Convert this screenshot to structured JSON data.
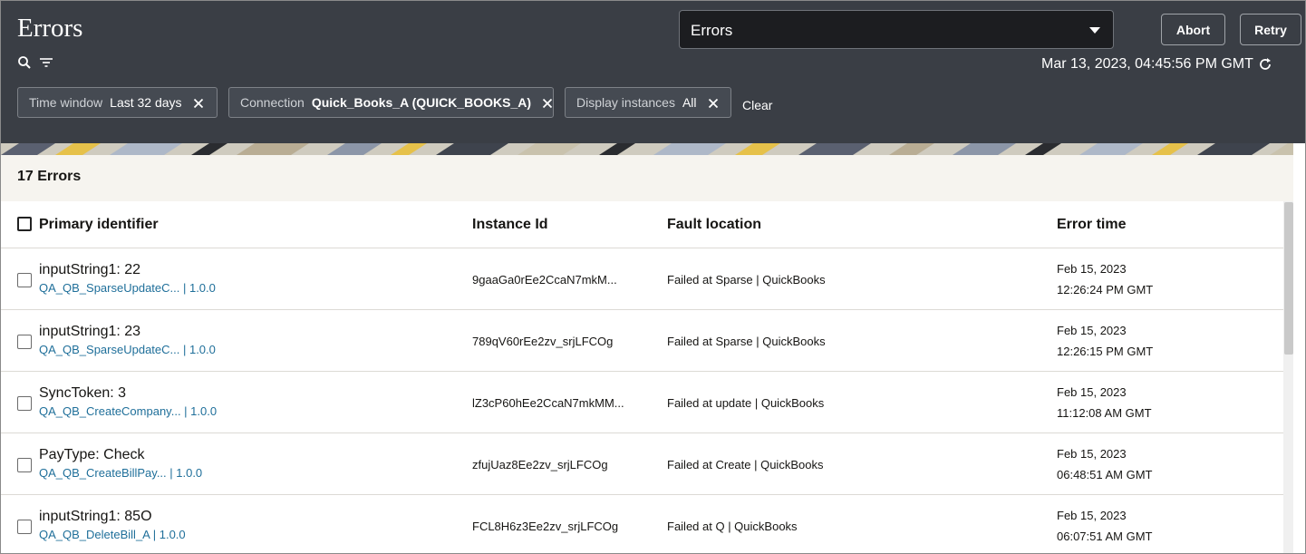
{
  "header": {
    "title": "Errors",
    "view_select": {
      "value": "Errors"
    },
    "abort_label": "Abort",
    "retry_label": "Retry",
    "timestamp": "Mar 13, 2023, 04:45:56 PM GMT",
    "icons": [
      "search-icon",
      "filter-icon",
      "refresh-icon",
      "chevron-down-icon"
    ]
  },
  "filters": [
    {
      "key": "Time window",
      "value": "Last 32 days"
    },
    {
      "key": "Connection",
      "value": "Quick_Books_A (QUICK_BOOKS_A)"
    },
    {
      "key": "Display instances",
      "value": "All"
    }
  ],
  "clear_label": "Clear",
  "summary": "17 Errors",
  "table": {
    "columns": [
      "Primary identifier",
      "Instance Id",
      "Fault location",
      "Error time"
    ],
    "rows": [
      {
        "identifier": "inputString1: 22",
        "integration": "QA_QB_SparseUpdateC... | 1.0.0",
        "instance_id": "9gaaGa0rEe2CcaN7mkM...",
        "fault": "Failed at Sparse | QuickBooks",
        "date": "Feb 15, 2023",
        "time": "12:26:24 PM GMT"
      },
      {
        "identifier": "inputString1: 23",
        "integration": "QA_QB_SparseUpdateC... | 1.0.0",
        "instance_id": "789qV60rEe2zv_srjLFCOg",
        "fault": "Failed at Sparse | QuickBooks",
        "date": "Feb 15, 2023",
        "time": "12:26:15 PM GMT"
      },
      {
        "identifier": "SyncToken: 3",
        "integration": "QA_QB_CreateCompany... | 1.0.0",
        "instance_id": "lZ3cP60hEe2CcaN7mkMM...",
        "fault": "Failed at update | QuickBooks",
        "date": "Feb 15, 2023",
        "time": "11:12:08 AM GMT"
      },
      {
        "identifier": "PayType: Check",
        "integration": "QA_QB_CreateBillPay... | 1.0.0",
        "instance_id": "zfujUaz8Ee2zv_srjLFCOg",
        "fault": "Failed at Create | QuickBooks",
        "date": "Feb 15, 2023",
        "time": "06:48:51 AM GMT"
      },
      {
        "identifier": "inputString1: 85O",
        "integration": "QA_QB_DeleteBill_A | 1.0.0",
        "instance_id": "FCL8H6z3Ee2zv_srjLFCOg",
        "fault": "Failed at Q | QuickBooks",
        "date": "Feb 15, 2023",
        "time": "06:07:51 AM GMT"
      }
    ]
  },
  "colors": {
    "header_bg": "#3a3e45",
    "link": "#1f6f9a",
    "summary_bg": "#f6f4ef"
  }
}
